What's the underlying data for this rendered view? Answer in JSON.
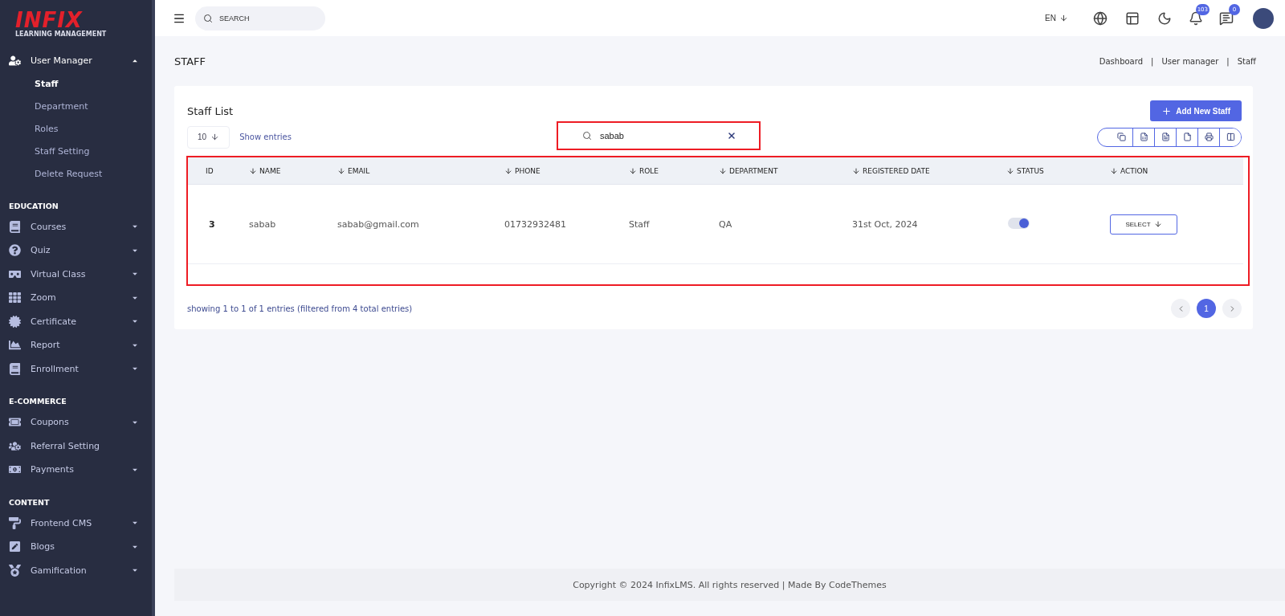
{
  "sidebar": {
    "logo": {
      "title": "INFIX",
      "subtitle": "LEARNING MANAGEMENT"
    },
    "groups": [
      {
        "items": [
          {
            "label": "User Manager",
            "expanded": true,
            "children": [
              {
                "label": "Staff",
                "selected": true
              },
              {
                "label": "Department",
                "selected": false
              },
              {
                "label": "Roles",
                "selected": false
              },
              {
                "label": "Staff Setting",
                "selected": false
              },
              {
                "label": "Delete Request",
                "selected": false
              }
            ]
          }
        ]
      },
      {
        "heading": "EDUCATION",
        "items": [
          {
            "label": "Courses",
            "expanded": false
          },
          {
            "label": "Quiz",
            "expanded": false
          },
          {
            "label": "Virtual Class",
            "expanded": false
          },
          {
            "label": "Zoom",
            "expanded": false
          },
          {
            "label": "Certificate",
            "expanded": false
          },
          {
            "label": "Report",
            "expanded": false
          },
          {
            "label": "Enrollment",
            "expanded": false
          }
        ]
      },
      {
        "heading": "E-COMMERCE",
        "items": [
          {
            "label": "Coupons",
            "expanded": false
          },
          {
            "label": "Referral Setting"
          },
          {
            "label": "Payments",
            "expanded": false
          }
        ]
      },
      {
        "heading": "CONTENT",
        "items": [
          {
            "label": "Frontend CMS",
            "expanded": false
          },
          {
            "label": "Blogs",
            "expanded": false
          },
          {
            "label": "Gamification",
            "expanded": false
          }
        ]
      }
    ]
  },
  "topbar": {
    "search": {
      "placeholder": "SEARCH"
    },
    "language": "EN",
    "notifications_badge": "103",
    "messages_badge": "0"
  },
  "page": {
    "title": "STAFF",
    "breadcrumb": [
      "Dashboard",
      "User manager",
      "Staff"
    ],
    "breadcrumb_separator": "|"
  },
  "card": {
    "title": "Staff List",
    "add_button": "Add New Staff",
    "entries": {
      "value": "10",
      "label": "Show entries"
    },
    "search": {
      "value": "sabab"
    },
    "table": {
      "columns": [
        {
          "label": "ID",
          "sortable": false
        },
        {
          "label": "NAME",
          "sortable": true
        },
        {
          "label": "EMAIL",
          "sortable": true
        },
        {
          "label": "PHONE",
          "sortable": true
        },
        {
          "label": "ROLE",
          "sortable": true
        },
        {
          "label": "DEPARTMENT",
          "sortable": true
        },
        {
          "label": "REGISTERED DATE",
          "sortable": true
        },
        {
          "label": "STATUS",
          "sortable": true
        },
        {
          "label": "ACTION",
          "sortable": true
        }
      ],
      "rows": [
        {
          "id": "3",
          "name": "sabab",
          "email": "sabab@gmail.com",
          "phone": "01732932481",
          "role": "Staff",
          "department": "QA",
          "registered": "31st Oct, 2024",
          "status_on": true,
          "action": "SELECT"
        }
      ]
    },
    "info": "showing 1 to 1 of 1 entries (filtered from 4 total entries)",
    "pages": [
      {
        "label": "1",
        "selected": true
      }
    ]
  },
  "footer": "Copyright © 2024 InfixLMS. All rights reserved | Made By CodeThemes"
}
